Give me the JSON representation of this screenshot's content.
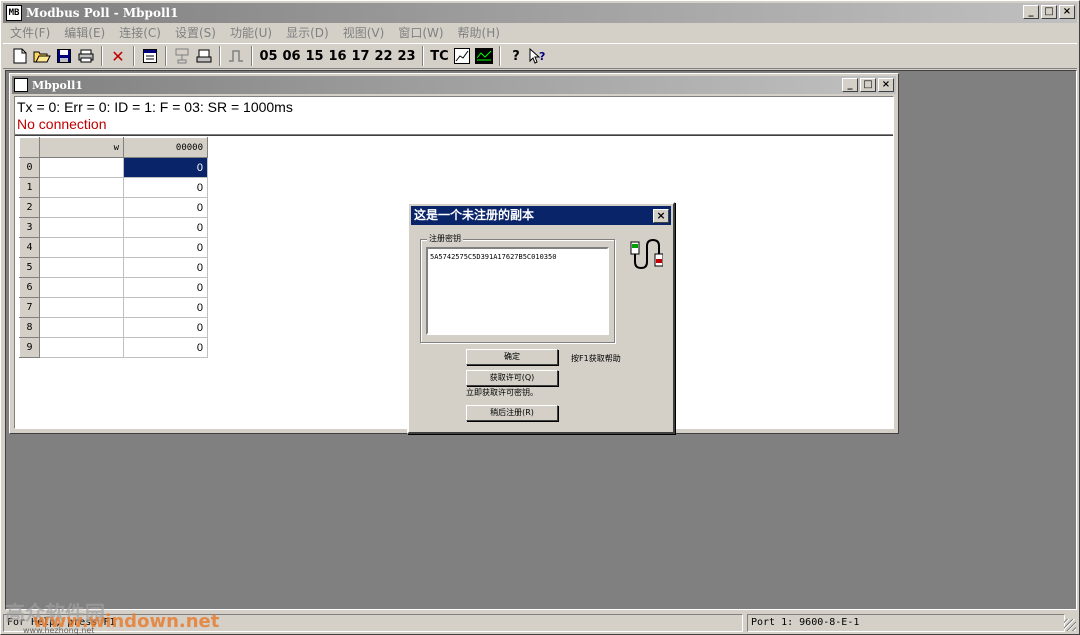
{
  "app": {
    "title": "Modbus Poll - Mbpoll1",
    "icon_text": "MB",
    "window_buttons": {
      "minimize": "_",
      "maximize": "□",
      "close": "×"
    }
  },
  "menu": [
    "文件(F)",
    "编辑(E)",
    "连接(C)",
    "设置(S)",
    "功能(U)",
    "显示(D)",
    "视图(V)",
    "窗口(W)",
    "帮助(H)"
  ],
  "toolbar": {
    "codes": [
      "05",
      "06",
      "15",
      "16",
      "17",
      "22",
      "23"
    ],
    "tc_label": "TC",
    "help_label": "?",
    "context_help_label": "?"
  },
  "child": {
    "title": "Mbpoll1",
    "status_line": "Tx = 0: Err = 0: ID = 1: F = 03: SR = 1000ms",
    "connection_status": "No connection",
    "grid": {
      "col_name_header": "w",
      "col_value_header": "00000",
      "rows": [
        {
          "index": "0",
          "value": "0"
        },
        {
          "index": "1",
          "value": "0"
        },
        {
          "index": "2",
          "value": "0"
        },
        {
          "index": "3",
          "value": "0"
        },
        {
          "index": "4",
          "value": "0"
        },
        {
          "index": "5",
          "value": "0"
        },
        {
          "index": "6",
          "value": "0"
        },
        {
          "index": "7",
          "value": "0"
        },
        {
          "index": "8",
          "value": "0"
        },
        {
          "index": "9",
          "value": "0"
        }
      ]
    }
  },
  "dialog": {
    "title": "这是一个未注册的副本",
    "group_label": "注册密钥",
    "key_value": "5A5742575C5D391A17627B5C010350",
    "ok_label": "确定",
    "f1_help": "按F1获取帮助",
    "get_license_label": "获取许可(Q)",
    "get_license_hint": "立即获取许可密钥。",
    "register_later_label": "稍后注册(R)"
  },
  "statusbar": {
    "left": "For Help, press F1",
    "port": "Port 1: 9600-8-E-1"
  },
  "watermark": {
    "cn": "高众软件园",
    "en": "www.windown.net",
    "small": "www.hezhong.net"
  }
}
